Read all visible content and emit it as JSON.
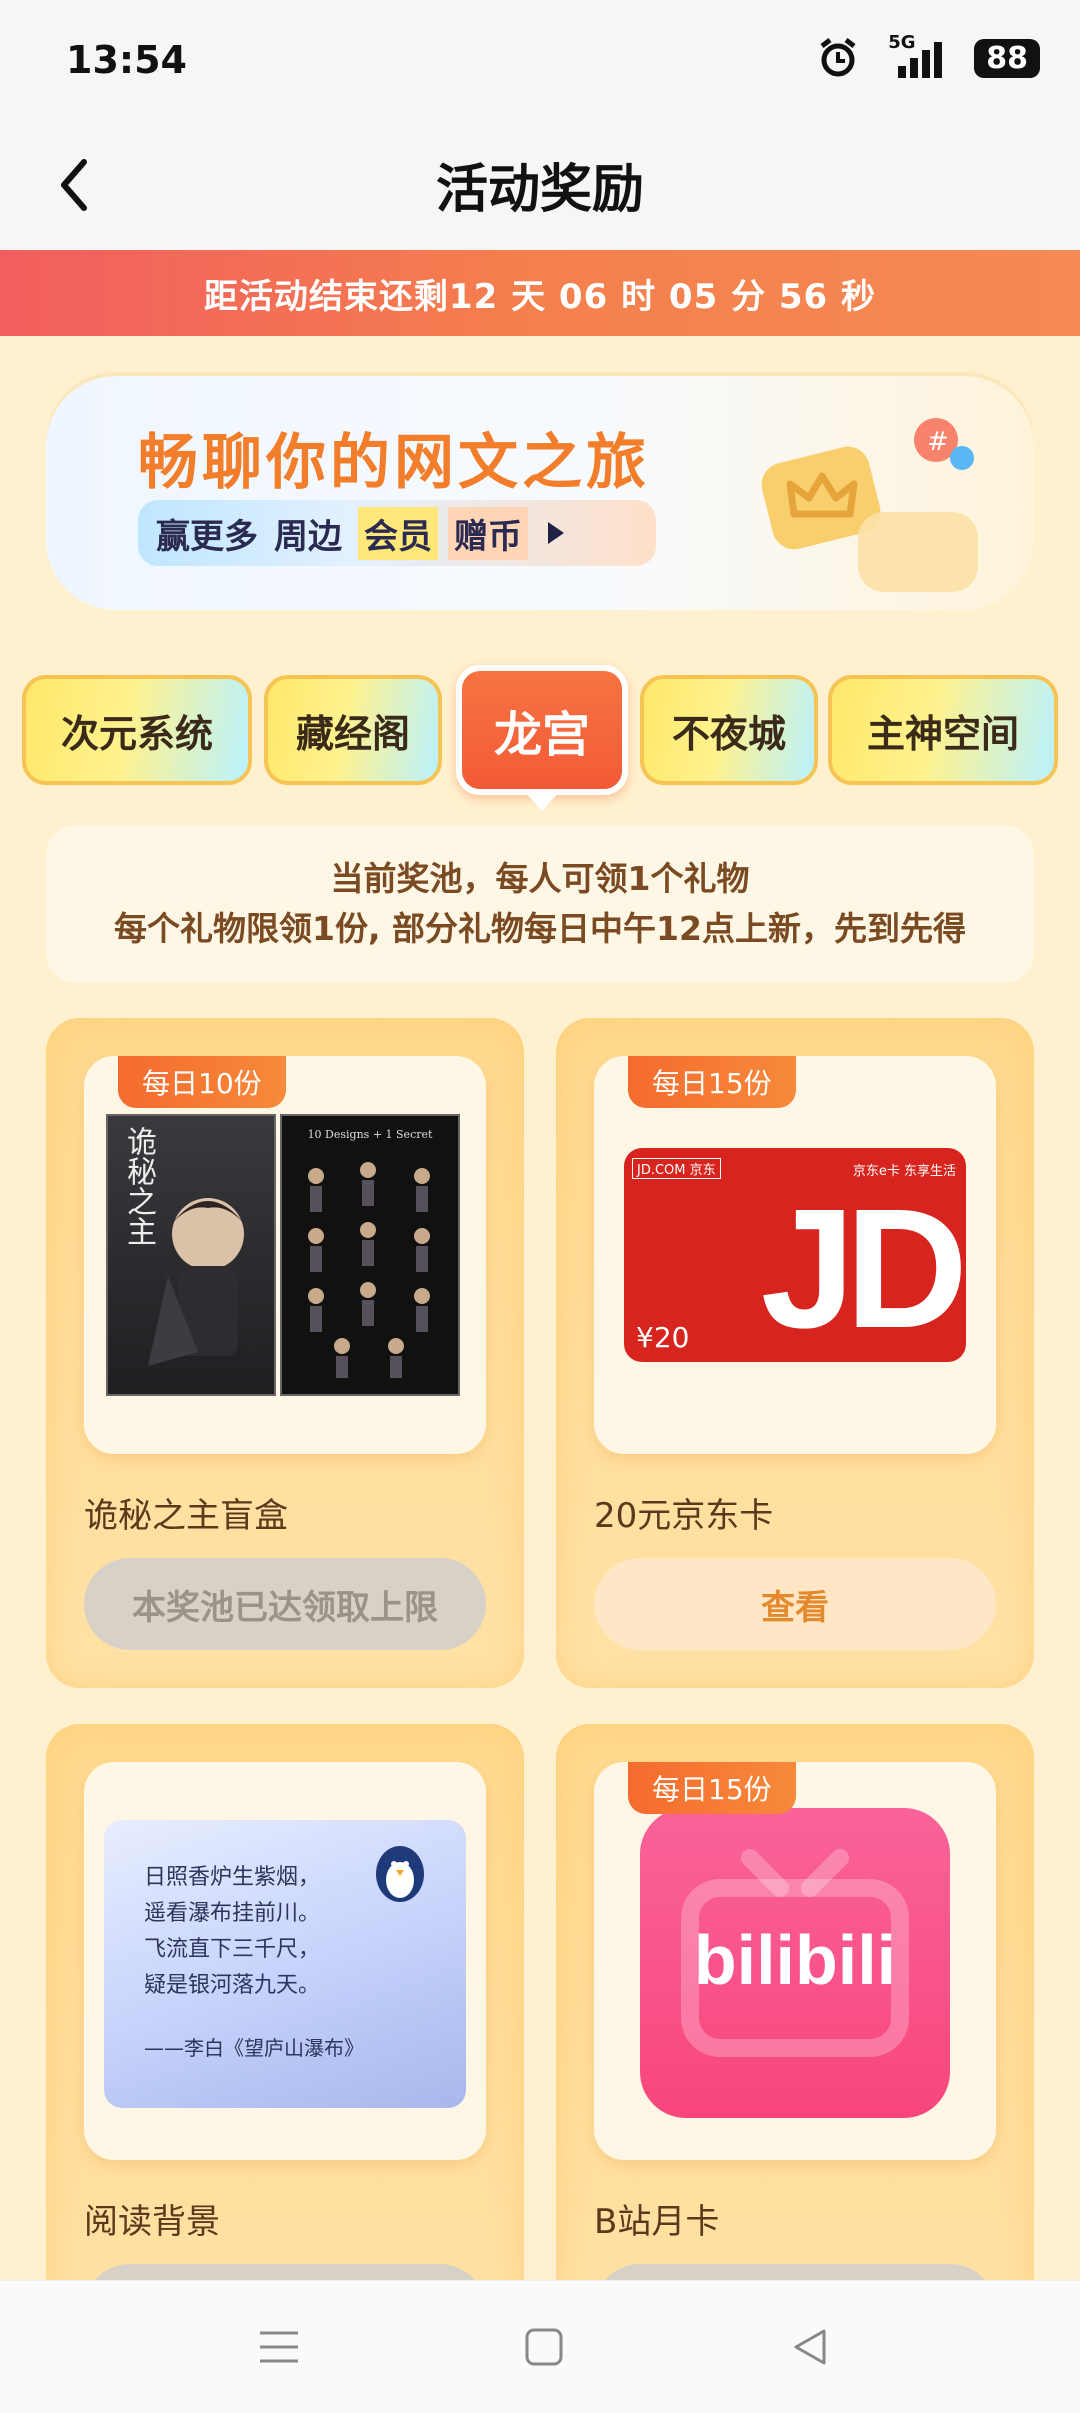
{
  "status": {
    "time": "13:54",
    "network": "5G",
    "battery": "88"
  },
  "header": {
    "title": "活动奖励"
  },
  "countdown": {
    "text": "距活动结束还剩12 天 06 时 05 分 56 秒"
  },
  "banner": {
    "title": "畅聊你的网文之旅",
    "subtitle_prefix": "赢更多",
    "tags": [
      "周边",
      "会员",
      "赠币"
    ]
  },
  "tabs": [
    {
      "label": "次元系统",
      "active": false
    },
    {
      "label": "藏经阁",
      "active": false
    },
    {
      "label": "龙宫",
      "active": true
    },
    {
      "label": "不夜城",
      "active": false
    },
    {
      "label": "主神空间",
      "active": false
    }
  ],
  "notice": {
    "line1": "当前奖池，每人可领1个礼物",
    "line2": "每个礼物限领1份, 部分礼物每日中午12点上新，先到先得"
  },
  "gifts": [
    {
      "badge": "每日10份",
      "name": "诡秘之主盲盒",
      "button": "本奖池已达领取上限",
      "box_text": "10 Designs + 1 Secret",
      "box_cover": "诡秘之主"
    },
    {
      "badge": "每日15份",
      "name": "20元京东卡",
      "button": "查看",
      "card_brand": "JD.COM 京东",
      "card_corner": "京东e卡 东享生活",
      "card_logo": "JD",
      "card_value": "¥20"
    },
    {
      "badge": "",
      "name": "阅读背景",
      "button": "",
      "poem": [
        "日照香炉生紫烟，",
        "遥看瀑布挂前川。",
        "飞流直下三千尺，",
        "疑是银河落九天。"
      ],
      "poem_author": "——李白《望庐山瀑布》"
    },
    {
      "badge": "每日15份",
      "name": "B站月卡",
      "button": "",
      "logo_text": "bilibili"
    }
  ],
  "colors": {
    "accent": "#F4804D",
    "page_bg": "#FFF1CF",
    "countdown_bg": "#F25E5E"
  }
}
